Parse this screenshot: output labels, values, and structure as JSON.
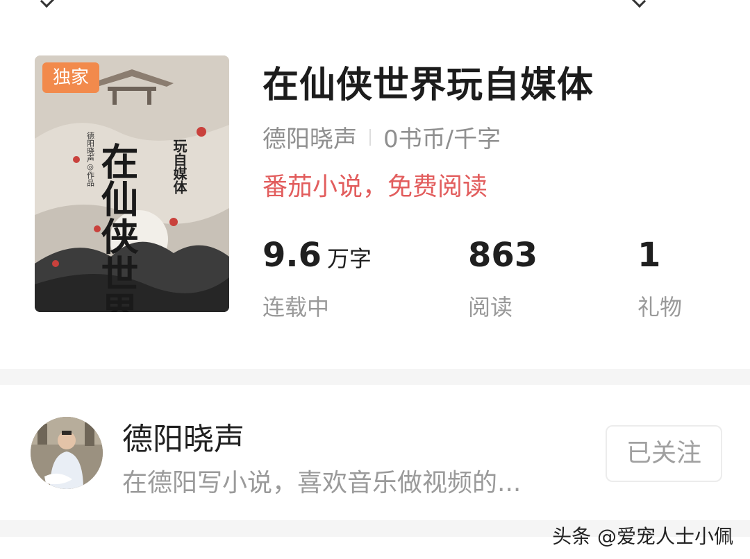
{
  "book": {
    "badge": "独家",
    "title": "在仙侠世界玩自媒体",
    "author": "德阳晓声",
    "price": "0书币/千字",
    "promo": "番茄小说，免费阅读",
    "cover_title": "在仙侠世界",
    "cover_subtitle": "玩自媒体",
    "cover_author": "德阳晓声◎作品",
    "stats": [
      {
        "value": "9.6",
        "unit": "万字",
        "label": "连载中"
      },
      {
        "value": "863",
        "unit": "",
        "label": "阅读"
      },
      {
        "value": "1",
        "unit": "",
        "label": "礼物"
      }
    ]
  },
  "author_card": {
    "name": "德阳晓声",
    "bio": "在德阳写小说，喜欢音乐做视频的...",
    "follow_label": "已关注"
  },
  "watermark": "头条 @爱宠人士小佩",
  "colors": {
    "badge": "#f28a4c",
    "promo": "#e25d5d",
    "divider": "#f5f5f5"
  }
}
